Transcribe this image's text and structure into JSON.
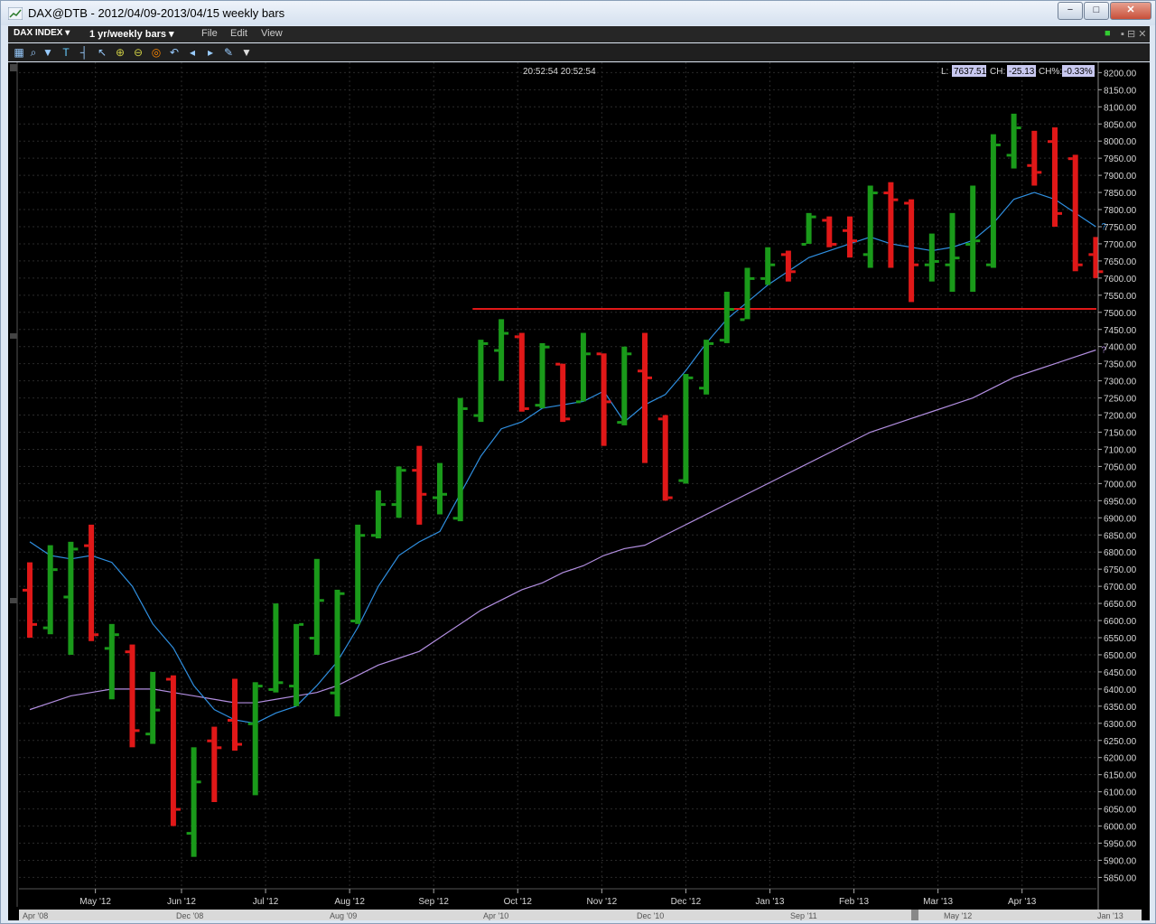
{
  "window": {
    "title": "DAX@DTB - 2012/04/09-2013/04/15 weekly bars",
    "btn_min": "−",
    "btn_max": "□",
    "btn_close": "✕"
  },
  "menubar": {
    "symbol": "DAX INDEX ▾",
    "period": "1 yr/weekly bars ▾",
    "file": "File",
    "edit": "Edit",
    "view": "View"
  },
  "toolbar": {
    "icons": [
      "chart-icon",
      "cursor-icon",
      "bar-style-icon",
      "trendline-icon",
      "zoom-in-icon",
      "zoom-out-icon",
      "target-icon",
      "undo-icon",
      "scroll-left-icon",
      "scroll-right-icon",
      "wrench-icon",
      "dropdown-icon"
    ]
  },
  "header": {
    "time": "20:52:54 20:52:54",
    "l_label": "L:",
    "l_value": "7637.51",
    "ch_label": "CH:",
    "ch_value": "-25.13",
    "chp_label": "CH%:",
    "chp_value": "-0.33%"
  },
  "colors": {
    "up": "#1a9a1a",
    "down": "#e01818",
    "ma_short": "#2f8fe0",
    "ma_long": "#b28ee0",
    "hline": "#e01818",
    "bg": "#000000",
    "grid": "#2a2a2a"
  },
  "chart_data": {
    "type": "bar",
    "ylim": [
      5830,
      8230
    ],
    "y_ticks": [
      5850,
      5900,
      5950,
      6000,
      6050,
      6100,
      6150,
      6200,
      6250,
      6300,
      6350,
      6400,
      6450,
      6500,
      6550,
      6600,
      6650,
      6700,
      6750,
      6800,
      6850,
      6900,
      6950,
      7000,
      7050,
      7100,
      7150,
      7200,
      7250,
      7300,
      7350,
      7400,
      7450,
      7500,
      7550,
      7600,
      7650,
      7700,
      7750,
      7800,
      7850,
      7900,
      7950,
      8000,
      8050,
      8100,
      8150,
      8200
    ],
    "x_labels": [
      "May '12",
      "Jun '12",
      "Jul '12",
      "Aug '12",
      "Sep '12",
      "Oct '12",
      "Nov '12",
      "Dec '12",
      "Jan '13",
      "Feb '13",
      "Mar '13",
      "Apr '13"
    ],
    "x_label_week_index": [
      3.2,
      7.4,
      11.5,
      15.6,
      19.7,
      23.8,
      27.9,
      32.0,
      36.1,
      40.2,
      44.3,
      48.4
    ],
    "bars": [
      {
        "o": 6690,
        "h": 6770,
        "l": 6550,
        "c": 6590
      },
      {
        "o": 6580,
        "h": 6820,
        "l": 6560,
        "c": 6750
      },
      {
        "o": 6670,
        "h": 6830,
        "l": 6500,
        "c": 6810
      },
      {
        "o": 6820,
        "h": 6880,
        "l": 6540,
        "c": 6560
      },
      {
        "o": 6520,
        "h": 6590,
        "l": 6370,
        "c": 6560
      },
      {
        "o": 6510,
        "h": 6530,
        "l": 6230,
        "c": 6280
      },
      {
        "o": 6270,
        "h": 6450,
        "l": 6240,
        "c": 6340
      },
      {
        "o": 6430,
        "h": 6440,
        "l": 6000,
        "c": 6050
      },
      {
        "o": 5980,
        "h": 6230,
        "l": 5910,
        "c": 6130
      },
      {
        "o": 6250,
        "h": 6290,
        "l": 6070,
        "c": 6230
      },
      {
        "o": 6310,
        "h": 6430,
        "l": 6220,
        "c": 6240
      },
      {
        "o": 6300,
        "h": 6420,
        "l": 6090,
        "c": 6410
      },
      {
        "o": 6400,
        "h": 6650,
        "l": 6390,
        "c": 6420
      },
      {
        "o": 6410,
        "h": 6590,
        "l": 6350,
        "c": 6590
      },
      {
        "o": 6550,
        "h": 6780,
        "l": 6500,
        "c": 6660
      },
      {
        "o": 6390,
        "h": 6690,
        "l": 6320,
        "c": 6680
      },
      {
        "o": 6600,
        "h": 6880,
        "l": 6590,
        "c": 6850
      },
      {
        "o": 6850,
        "h": 6980,
        "l": 6840,
        "c": 6940
      },
      {
        "o": 6940,
        "h": 7050,
        "l": 6900,
        "c": 7040
      },
      {
        "o": 7040,
        "h": 7110,
        "l": 6880,
        "c": 6970
      },
      {
        "o": 6960,
        "h": 7060,
        "l": 6910,
        "c": 6970
      },
      {
        "o": 6900,
        "h": 7250,
        "l": 6890,
        "c": 7220
      },
      {
        "o": 7200,
        "h": 7420,
        "l": 7180,
        "c": 7410
      },
      {
        "o": 7390,
        "h": 7480,
        "l": 7300,
        "c": 7440
      },
      {
        "o": 7430,
        "h": 7440,
        "l": 7210,
        "c": 7220
      },
      {
        "o": 7230,
        "h": 7410,
        "l": 7220,
        "c": 7400
      },
      {
        "o": 7350,
        "h": 7350,
        "l": 7180,
        "c": 7190
      },
      {
        "o": 7240,
        "h": 7440,
        "l": 7240,
        "c": 7380
      },
      {
        "o": 7380,
        "h": 7380,
        "l": 7110,
        "c": 7240
      },
      {
        "o": 7180,
        "h": 7400,
        "l": 7170,
        "c": 7380
      },
      {
        "o": 7330,
        "h": 7440,
        "l": 7060,
        "c": 7310
      },
      {
        "o": 7190,
        "h": 7200,
        "l": 6950,
        "c": 6960
      },
      {
        "o": 7010,
        "h": 7320,
        "l": 7000,
        "c": 7310
      },
      {
        "o": 7280,
        "h": 7420,
        "l": 7260,
        "c": 7410
      },
      {
        "o": 7420,
        "h": 7560,
        "l": 7410,
        "c": 7510
      },
      {
        "o": 7480,
        "h": 7630,
        "l": 7480,
        "c": 7600
      },
      {
        "o": 7600,
        "h": 7690,
        "l": 7580,
        "c": 7640
      },
      {
        "o": 7670,
        "h": 7680,
        "l": 7590,
        "c": 7620
      },
      {
        "o": 7700,
        "h": 7790,
        "l": 7700,
        "c": 7780
      },
      {
        "o": 7770,
        "h": 7780,
        "l": 7690,
        "c": 7700
      },
      {
        "o": 7740,
        "h": 7780,
        "l": 7660,
        "c": 7710
      },
      {
        "o": 7670,
        "h": 7870,
        "l": 7630,
        "c": 7850
      },
      {
        "o": 7850,
        "h": 7880,
        "l": 7630,
        "c": 7830
      },
      {
        "o": 7820,
        "h": 7830,
        "l": 7530,
        "c": 7640
      },
      {
        "o": 7640,
        "h": 7730,
        "l": 7590,
        "c": 7650
      },
      {
        "o": 7640,
        "h": 7790,
        "l": 7560,
        "c": 7660
      },
      {
        "o": 7700,
        "h": 7870,
        "l": 7560,
        "c": 7710
      },
      {
        "o": 7640,
        "h": 8020,
        "l": 7630,
        "c": 7990
      },
      {
        "o": 7960,
        "h": 8080,
        "l": 7920,
        "c": 8040
      },
      {
        "o": 7930,
        "h": 8030,
        "l": 7870,
        "c": 7910
      },
      {
        "o": 8000,
        "h": 8040,
        "l": 7750,
        "c": 7790
      },
      {
        "o": 7950,
        "h": 7960,
        "l": 7620,
        "c": 7640
      },
      {
        "o": 7670,
        "h": 7720,
        "l": 7600,
        "c": 7620
      }
    ],
    "ma_short": [
      6830,
      6790,
      6780,
      6790,
      6770,
      6700,
      6590,
      6520,
      6410,
      6340,
      6310,
      6300,
      6330,
      6350,
      6410,
      6480,
      6580,
      6700,
      6790,
      6830,
      6860,
      6970,
      7080,
      7160,
      7180,
      7220,
      7230,
      7240,
      7270,
      7180,
      7230,
      7260,
      7330,
      7410,
      7480,
      7530,
      7580,
      7620,
      7660,
      7680,
      7700,
      7720,
      7700,
      7690,
      7680,
      7690,
      7710,
      7760,
      7830,
      7850,
      7830,
      7790,
      7750
    ],
    "ma_long": [
      6340,
      6360,
      6380,
      6390,
      6400,
      6400,
      6400,
      6390,
      6380,
      6370,
      6360,
      6360,
      6370,
      6380,
      6390,
      6410,
      6440,
      6470,
      6490,
      6510,
      6550,
      6590,
      6630,
      6660,
      6690,
      6710,
      6740,
      6760,
      6790,
      6810,
      6820,
      6850,
      6880,
      6910,
      6940,
      6970,
      7000,
      7030,
      7060,
      7090,
      7120,
      7150,
      7170,
      7190,
      7210,
      7230,
      7250,
      7280,
      7310,
      7330,
      7350,
      7370,
      7390
    ],
    "hline": {
      "value": 7510,
      "from_week": 21.6
    },
    "ma_end_marker": "?"
  },
  "bottom_axis": {
    "labels": [
      "Apr '08",
      "Dec '08",
      "Aug '09",
      "Apr '10",
      "Dec '10",
      "Sep '11",
      "May '12",
      "Jan '13"
    ]
  }
}
